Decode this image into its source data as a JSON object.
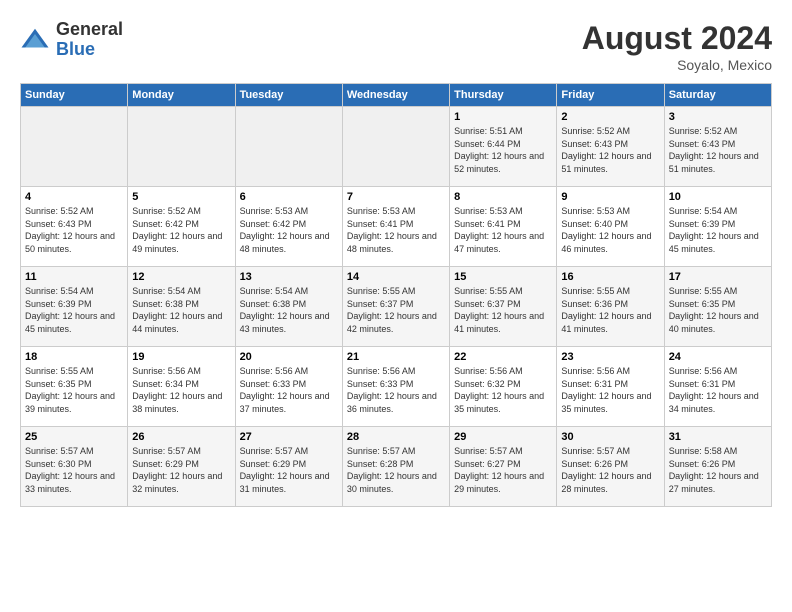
{
  "header": {
    "logo_general": "General",
    "logo_blue": "Blue",
    "month_year": "August 2024",
    "location": "Soyalo, Mexico"
  },
  "days_of_week": [
    "Sunday",
    "Monday",
    "Tuesday",
    "Wednesday",
    "Thursday",
    "Friday",
    "Saturday"
  ],
  "weeks": [
    [
      {
        "day": "",
        "sunrise": "",
        "sunset": "",
        "daylight": ""
      },
      {
        "day": "",
        "sunrise": "",
        "sunset": "",
        "daylight": ""
      },
      {
        "day": "",
        "sunrise": "",
        "sunset": "",
        "daylight": ""
      },
      {
        "day": "",
        "sunrise": "",
        "sunset": "",
        "daylight": ""
      },
      {
        "day": "1",
        "sunrise": "Sunrise: 5:51 AM",
        "sunset": "Sunset: 6:44 PM",
        "daylight": "Daylight: 12 hours and 52 minutes."
      },
      {
        "day": "2",
        "sunrise": "Sunrise: 5:52 AM",
        "sunset": "Sunset: 6:43 PM",
        "daylight": "Daylight: 12 hours and 51 minutes."
      },
      {
        "day": "3",
        "sunrise": "Sunrise: 5:52 AM",
        "sunset": "Sunset: 6:43 PM",
        "daylight": "Daylight: 12 hours and 51 minutes."
      }
    ],
    [
      {
        "day": "4",
        "sunrise": "Sunrise: 5:52 AM",
        "sunset": "Sunset: 6:43 PM",
        "daylight": "Daylight: 12 hours and 50 minutes."
      },
      {
        "day": "5",
        "sunrise": "Sunrise: 5:52 AM",
        "sunset": "Sunset: 6:42 PM",
        "daylight": "Daylight: 12 hours and 49 minutes."
      },
      {
        "day": "6",
        "sunrise": "Sunrise: 5:53 AM",
        "sunset": "Sunset: 6:42 PM",
        "daylight": "Daylight: 12 hours and 48 minutes."
      },
      {
        "day": "7",
        "sunrise": "Sunrise: 5:53 AM",
        "sunset": "Sunset: 6:41 PM",
        "daylight": "Daylight: 12 hours and 48 minutes."
      },
      {
        "day": "8",
        "sunrise": "Sunrise: 5:53 AM",
        "sunset": "Sunset: 6:41 PM",
        "daylight": "Daylight: 12 hours and 47 minutes."
      },
      {
        "day": "9",
        "sunrise": "Sunrise: 5:53 AM",
        "sunset": "Sunset: 6:40 PM",
        "daylight": "Daylight: 12 hours and 46 minutes."
      },
      {
        "day": "10",
        "sunrise": "Sunrise: 5:54 AM",
        "sunset": "Sunset: 6:39 PM",
        "daylight": "Daylight: 12 hours and 45 minutes."
      }
    ],
    [
      {
        "day": "11",
        "sunrise": "Sunrise: 5:54 AM",
        "sunset": "Sunset: 6:39 PM",
        "daylight": "Daylight: 12 hours and 45 minutes."
      },
      {
        "day": "12",
        "sunrise": "Sunrise: 5:54 AM",
        "sunset": "Sunset: 6:38 PM",
        "daylight": "Daylight: 12 hours and 44 minutes."
      },
      {
        "day": "13",
        "sunrise": "Sunrise: 5:54 AM",
        "sunset": "Sunset: 6:38 PM",
        "daylight": "Daylight: 12 hours and 43 minutes."
      },
      {
        "day": "14",
        "sunrise": "Sunrise: 5:55 AM",
        "sunset": "Sunset: 6:37 PM",
        "daylight": "Daylight: 12 hours and 42 minutes."
      },
      {
        "day": "15",
        "sunrise": "Sunrise: 5:55 AM",
        "sunset": "Sunset: 6:37 PM",
        "daylight": "Daylight: 12 hours and 41 minutes."
      },
      {
        "day": "16",
        "sunrise": "Sunrise: 5:55 AM",
        "sunset": "Sunset: 6:36 PM",
        "daylight": "Daylight: 12 hours and 41 minutes."
      },
      {
        "day": "17",
        "sunrise": "Sunrise: 5:55 AM",
        "sunset": "Sunset: 6:35 PM",
        "daylight": "Daylight: 12 hours and 40 minutes."
      }
    ],
    [
      {
        "day": "18",
        "sunrise": "Sunrise: 5:55 AM",
        "sunset": "Sunset: 6:35 PM",
        "daylight": "Daylight: 12 hours and 39 minutes."
      },
      {
        "day": "19",
        "sunrise": "Sunrise: 5:56 AM",
        "sunset": "Sunset: 6:34 PM",
        "daylight": "Daylight: 12 hours and 38 minutes."
      },
      {
        "day": "20",
        "sunrise": "Sunrise: 5:56 AM",
        "sunset": "Sunset: 6:33 PM",
        "daylight": "Daylight: 12 hours and 37 minutes."
      },
      {
        "day": "21",
        "sunrise": "Sunrise: 5:56 AM",
        "sunset": "Sunset: 6:33 PM",
        "daylight": "Daylight: 12 hours and 36 minutes."
      },
      {
        "day": "22",
        "sunrise": "Sunrise: 5:56 AM",
        "sunset": "Sunset: 6:32 PM",
        "daylight": "Daylight: 12 hours and 35 minutes."
      },
      {
        "day": "23",
        "sunrise": "Sunrise: 5:56 AM",
        "sunset": "Sunset: 6:31 PM",
        "daylight": "Daylight: 12 hours and 35 minutes."
      },
      {
        "day": "24",
        "sunrise": "Sunrise: 5:56 AM",
        "sunset": "Sunset: 6:31 PM",
        "daylight": "Daylight: 12 hours and 34 minutes."
      }
    ],
    [
      {
        "day": "25",
        "sunrise": "Sunrise: 5:57 AM",
        "sunset": "Sunset: 6:30 PM",
        "daylight": "Daylight: 12 hours and 33 minutes."
      },
      {
        "day": "26",
        "sunrise": "Sunrise: 5:57 AM",
        "sunset": "Sunset: 6:29 PM",
        "daylight": "Daylight: 12 hours and 32 minutes."
      },
      {
        "day": "27",
        "sunrise": "Sunrise: 5:57 AM",
        "sunset": "Sunset: 6:29 PM",
        "daylight": "Daylight: 12 hours and 31 minutes."
      },
      {
        "day": "28",
        "sunrise": "Sunrise: 5:57 AM",
        "sunset": "Sunset: 6:28 PM",
        "daylight": "Daylight: 12 hours and 30 minutes."
      },
      {
        "day": "29",
        "sunrise": "Sunrise: 5:57 AM",
        "sunset": "Sunset: 6:27 PM",
        "daylight": "Daylight: 12 hours and 29 minutes."
      },
      {
        "day": "30",
        "sunrise": "Sunrise: 5:57 AM",
        "sunset": "Sunset: 6:26 PM",
        "daylight": "Daylight: 12 hours and 28 minutes."
      },
      {
        "day": "31",
        "sunrise": "Sunrise: 5:58 AM",
        "sunset": "Sunset: 6:26 PM",
        "daylight": "Daylight: 12 hours and 27 minutes."
      }
    ]
  ]
}
